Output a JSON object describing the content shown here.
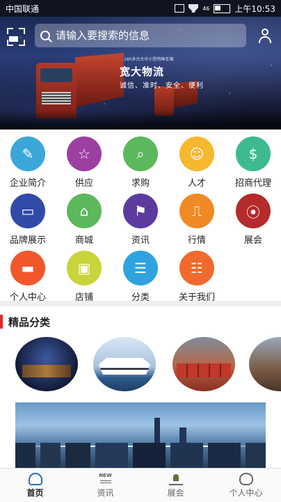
{
  "status_bar": {
    "carrier": "中国联通",
    "icons": "46",
    "time": "上午10:53"
  },
  "search": {
    "placeholder": "请输入要搜索的信息"
  },
  "banner": {
    "brand": "宽大物流",
    "tagline": "诚信、准时、安全、便利",
    "small_text": "180多台大中小型特种车辆"
  },
  "grid": [
    {
      "label": "企业简介",
      "icon": "edit-icon",
      "color": "#3aa7d8",
      "glyph": "✎"
    },
    {
      "label": "供应",
      "icon": "star-icon",
      "color": "#9c3fa0",
      "glyph": "☆"
    },
    {
      "label": "求购",
      "icon": "search-icon",
      "color": "#5cb85c",
      "glyph": "⌕"
    },
    {
      "label": "人才",
      "icon": "person-icon",
      "color": "#f5b82e",
      "glyph": "☺"
    },
    {
      "label": "招商代理",
      "icon": "dollar-icon",
      "color": "#3dbb8f",
      "glyph": "$"
    },
    {
      "label": "品牌展示",
      "icon": "screen-icon",
      "color": "#2f4aa8",
      "glyph": "▭"
    },
    {
      "label": "商城",
      "icon": "store-icon",
      "color": "#5cb85c",
      "glyph": "⌂"
    },
    {
      "label": "资讯",
      "icon": "flag-icon",
      "color": "#5b3c9e",
      "glyph": "⚑"
    },
    {
      "label": "行情",
      "icon": "chart-icon",
      "color": "#f08a24",
      "glyph": "⎍"
    },
    {
      "label": "展会",
      "icon": "location-icon",
      "color": "#b52a2a",
      "glyph": "⦿"
    },
    {
      "label": "个人中心",
      "icon": "folder-icon",
      "color": "#f2572b",
      "glyph": "▬"
    },
    {
      "label": "店铺",
      "icon": "box-icon",
      "color": "#c9d33a",
      "glyph": "▣"
    },
    {
      "label": "分类",
      "icon": "sliders-icon",
      "color": "#2fa3e0",
      "glyph": "☰"
    },
    {
      "label": "关于我们",
      "icon": "contact-card-icon",
      "color": "#f06a2e",
      "glyph": "☷"
    }
  ],
  "section": {
    "title": "精品分类"
  },
  "tabs": [
    {
      "label": "首页",
      "icon": "home-icon",
      "active": true
    },
    {
      "label": "资讯",
      "icon": "news-icon",
      "badge": "NEW",
      "active": false
    },
    {
      "label": "展会",
      "icon": "expo-icon",
      "active": false
    },
    {
      "label": "个人中心",
      "icon": "profile-icon",
      "active": false
    }
  ]
}
